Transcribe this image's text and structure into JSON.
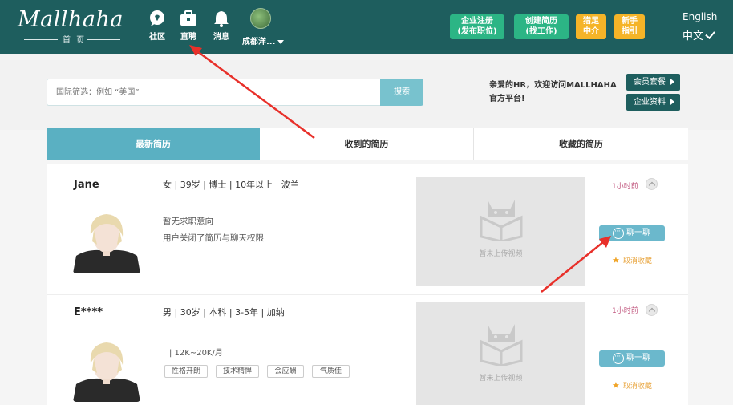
{
  "header": {
    "logo": "Mallhaha",
    "logo_sub": "首 页",
    "nav": [
      {
        "label": "社区",
        "icon": "chat-bubble-icon"
      },
      {
        "label": "直聘",
        "icon": "briefcase-icon"
      },
      {
        "label": "消息",
        "icon": "bell-icon"
      }
    ],
    "city": "成都洋...",
    "buttons": [
      {
        "line1": "企业注册",
        "line2": "(发布职位)",
        "color": "#2cb585"
      },
      {
        "line1": "创建简历",
        "line2": "(找工作)",
        "color": "#2cb585"
      },
      {
        "line1": "猎足",
        "line2": "中介",
        "color": "#f5b428"
      },
      {
        "line1": "新手",
        "line2": "指引",
        "color": "#f5b428"
      }
    ],
    "lang_en": "English",
    "lang_zh": "中文"
  },
  "search": {
    "placeholder": "国际筛选：例如 “美国”",
    "button": "搜索",
    "welcome": "亲爱的HR，欢迎访问MALLHAHA官方平台!",
    "member_btn": "会员套餐",
    "company_btn": "企业资料"
  },
  "tabs": [
    {
      "label": "最新简历",
      "active": true
    },
    {
      "label": "收到的简历",
      "active": false
    },
    {
      "label": "收藏的简历",
      "active": false
    }
  ],
  "resumes": [
    {
      "name": "Jane",
      "info": "女 | 39岁 | 博士 | 10年以上 | 波兰",
      "line1": "暂无求职意向",
      "line2": "用户关闭了简历与聊天权限",
      "video_caption": "暂未上传视频",
      "time": "1小时前",
      "chat": "聊一聊",
      "fav": "取消收藏"
    },
    {
      "name": "E****",
      "info": "男 | 30岁 | 本科 | 3-5年 | 加纳",
      "salary": "| 12K~20K/月",
      "tags": [
        "性格开朗",
        "技术精悍",
        "会应酬",
        "气质佳"
      ],
      "video_caption": "暂未上传视频",
      "time": "1小时前",
      "chat": "聊一聊",
      "fav": "取消收藏"
    }
  ],
  "colors": {
    "header": "#1e5e5e",
    "tab_active": "#5ab0c2",
    "chat_button": "#6bb8cc",
    "annotation_arrow": "#e8302a"
  }
}
